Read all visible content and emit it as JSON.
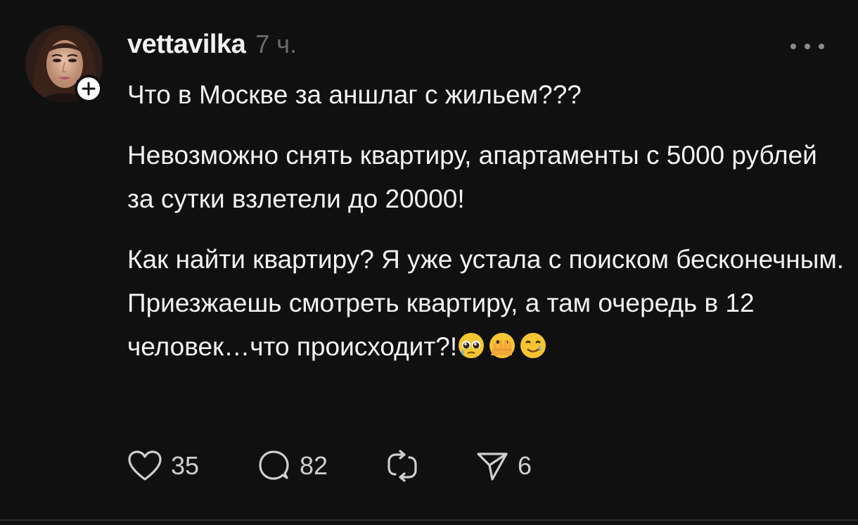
{
  "post": {
    "username": "vettavilka",
    "time": "7 ч.",
    "paragraphs": [
      "Что в Москве за аншлаг с жильем???",
      "Невозможно снять квартиру, апартаменты с 5000 рублей за сутки взлетели до 20000!",
      "Как найти квартиру? Я уже устала с поиском бесконечным.",
      "Приезжаешь смотреть квартиру, а там очередь в 12 человек…что происходит?!"
    ],
    "emojis": [
      "pleading-face-emoji",
      "face-with-open-eyes-and-hand-over-mouth-emoji",
      "smiling-face-with-tear-emoji"
    ]
  },
  "actions": {
    "likes": "35",
    "comments": "82",
    "reposts": "",
    "shares": "6"
  },
  "colors": {
    "background": "#101010",
    "text": "#f3f3f3",
    "muted": "#6c6c6c",
    "icon": "#cfcfcf"
  }
}
